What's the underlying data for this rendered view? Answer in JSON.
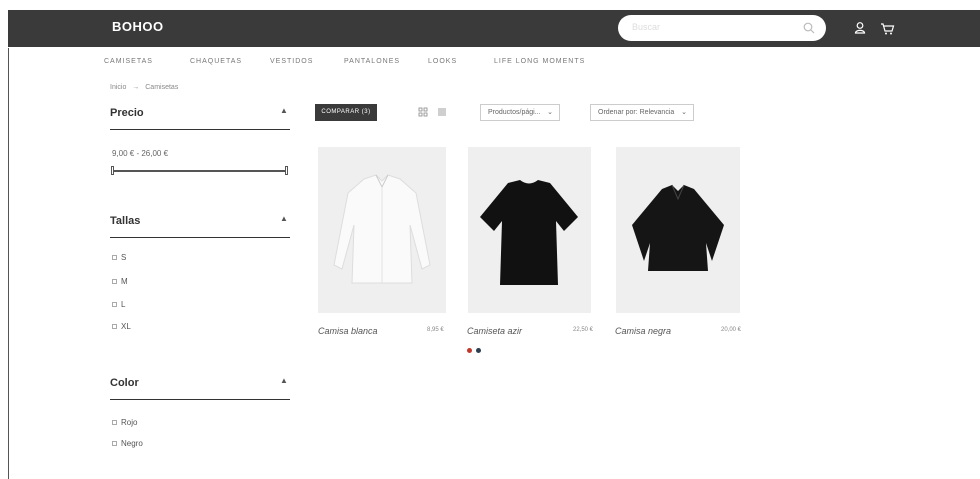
{
  "header": {
    "brand": "BOHOO",
    "search_placeholder": "Buscar",
    "icons": [
      "user-icon",
      "cart-icon"
    ]
  },
  "categories": [
    "CAMISETAS",
    "CHAQUETAS",
    "VESTIDOS",
    "PANTALONES",
    "LOOKS",
    "LIFE LONG MOMENTS"
  ],
  "breadcrumb": {
    "home": "Inicio",
    "separator": "→",
    "current": "Camisetas"
  },
  "filters": {
    "price": {
      "title": "Precio",
      "range_label": "9,00 € - 26,00 €"
    },
    "sizes": {
      "title": "Tallas",
      "options": [
        "S",
        "M",
        "L",
        "XL"
      ]
    },
    "color": {
      "title": "Color",
      "options": [
        "Rojo",
        "Negro"
      ]
    }
  },
  "toolbar": {
    "compare_label": "COMPARAR (3)",
    "products_per_page": "Productos/pági...",
    "sort_label": "Ordenar por: Relevancia"
  },
  "products": [
    {
      "name": "Camisa blanca",
      "price": "8,95 €",
      "image": "white-shirt"
    },
    {
      "name": "Camiseta azir",
      "price": "22,50 €",
      "image": "black-tshirt",
      "swatches": [
        "#c0392b",
        "#2c3e50"
      ]
    },
    {
      "name": "Camisa negra",
      "price": "20,00 €",
      "image": "black-cropped-shirt"
    }
  ],
  "colors": {
    "header_bg": "#3a3a3a",
    "accent_red": "#c0392b",
    "navy": "#2c3e50"
  }
}
